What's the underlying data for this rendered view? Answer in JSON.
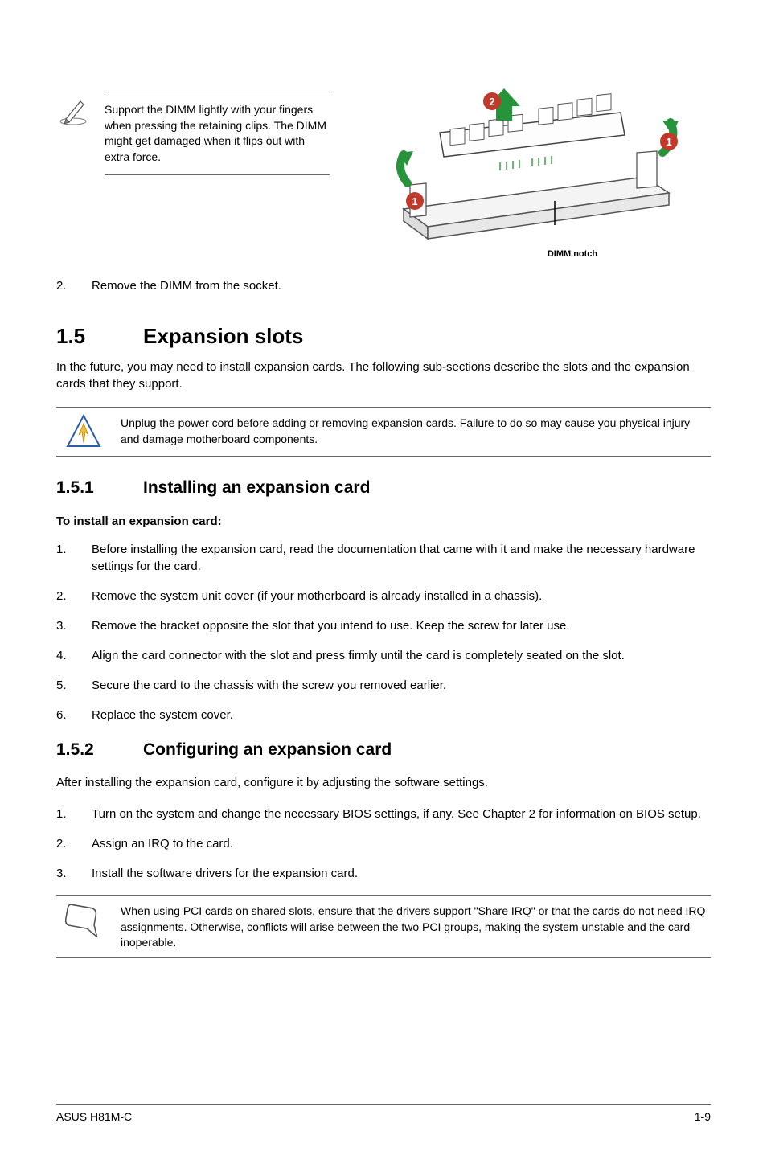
{
  "top_note": "Support the DIMM lightly with your fingers when pressing the retaining clips. The DIMM might get damaged when it flips out with extra force.",
  "dimm_label": "DIMM notch",
  "step2_top": "Remove the DIMM from the socket.",
  "sec15_num": "1.5",
  "sec15_title": "Expansion slots",
  "sec15_intro": "In the future, you may need to install expansion cards. The following sub-sections describe the slots and the expansion cards that they support.",
  "warn_text": "Unplug the power cord before adding or removing expansion cards. Failure to do so may cause you physical injury and damage motherboard components.",
  "sec151_num": "1.5.1",
  "sec151_title": "Installing an expansion card",
  "sec151_lead": "To install an expansion card:",
  "sec151_steps": [
    "Before installing the expansion card, read the documentation that came with it and make the necessary hardware settings for the card.",
    "Remove the system unit cover (if your motherboard is already installed in a chassis).",
    "Remove the bracket opposite the slot that you intend to use. Keep the screw for later use.",
    "Align the card connector with the slot and press firmly until the card is completely seated on the slot.",
    "Secure the card to the chassis with the screw you removed earlier.",
    "Replace the system cover."
  ],
  "sec152_num": "1.5.2",
  "sec152_title": "Configuring an expansion card",
  "sec152_intro": "After installing the expansion card, configure it by adjusting the software settings.",
  "sec152_steps": [
    "Turn on the system and change the necessary BIOS settings, if any. See Chapter 2 for information on BIOS setup.",
    "Assign an IRQ to the card.",
    "Install the software drivers for the expansion card."
  ],
  "note_bottom": "When using PCI cards on shared slots, ensure that the drivers support \"Share IRQ\" or that the cards do not need IRQ assignments. Otherwise, conflicts will arise between the two PCI groups, making the system unstable and the card inoperable.",
  "footer_left": "ASUS H81M-C",
  "footer_right": "1-9"
}
